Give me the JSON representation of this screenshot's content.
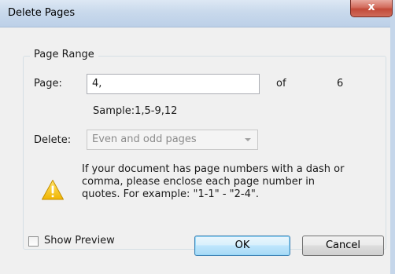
{
  "window": {
    "title": "Delete Pages"
  },
  "colors": {
    "titlebar": "#c9d9ec",
    "close_button": "#c24a39",
    "default_button_border": "#3c7fb1"
  },
  "group": {
    "legend": "Page Range"
  },
  "page_field": {
    "label": "Page:",
    "value": "4,",
    "of_label": "of",
    "total_pages": "6"
  },
  "sample": {
    "text": "Sample:1,5-9,12"
  },
  "delete_field": {
    "label": "Delete:",
    "selected": "Even and odd pages"
  },
  "notice": {
    "icon": "warning-icon",
    "lines": [
      "If your document has page numbers with a dash or",
      "comma, please enclose each page number in",
      "quotes. For example: \"1-1\" - \"2-4\"."
    ]
  },
  "show_preview": {
    "label": "Show Preview",
    "checked": false
  },
  "buttons": {
    "ok": "OK",
    "cancel": "Cancel"
  }
}
